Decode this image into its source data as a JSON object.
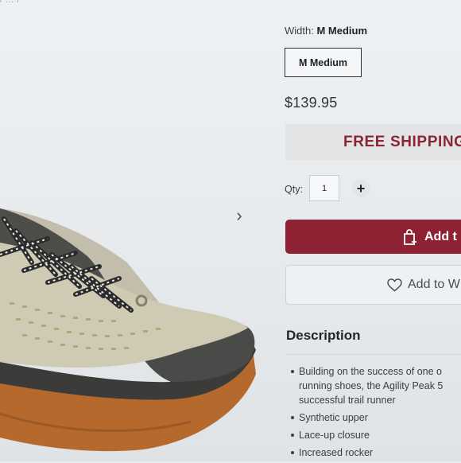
{
  "breadcrumb": "/ ... /",
  "product": {
    "width_label": "Width:",
    "width_value": "M Medium",
    "width_option": "M Medium",
    "price": "$139.95",
    "shipping_banner": "FREE SHIPPING",
    "qty_label": "Qty:",
    "qty_value": "1",
    "qty_plus": "+",
    "add_to_cart_label": "Add t",
    "wishlist_label": "Add to W"
  },
  "gallery": {
    "next_arrow": "›"
  },
  "description": {
    "heading": "Description",
    "items": [
      "Building on the success of one o",
      "running shoes, the Agility Peak 5",
      "successful trail runner",
      "Synthetic upper",
      "Lace-up closure",
      "Increased rocker"
    ]
  },
  "colors": {
    "brand": "#8e2232",
    "shipping_text": "#8c2533",
    "shoe_sole": "#b5692d",
    "shoe_upper": "#cfcab4"
  }
}
